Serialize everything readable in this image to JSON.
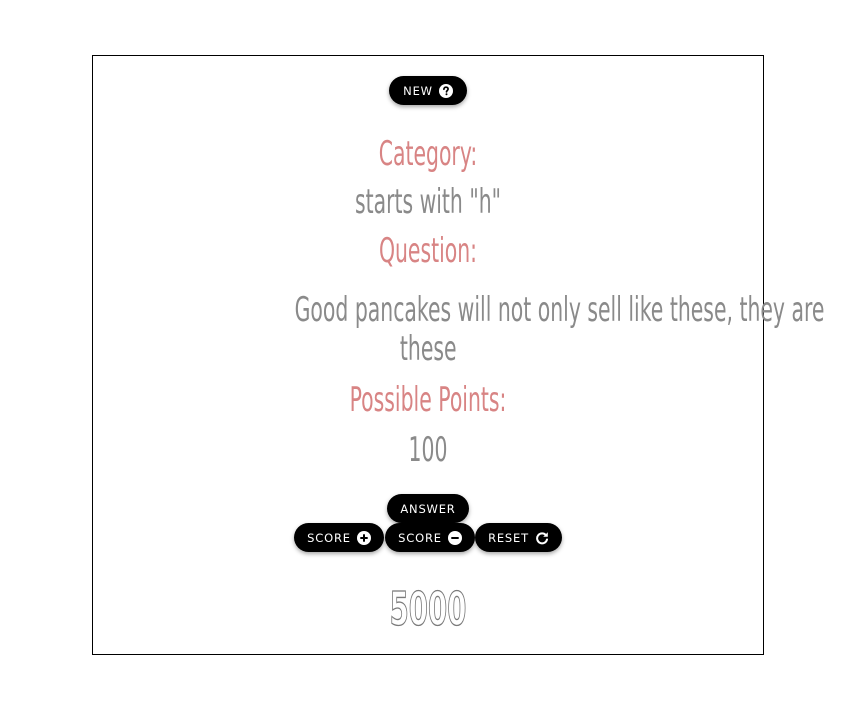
{
  "toolbar": {
    "new_label": "NEW",
    "new_icon": "question-circle-icon"
  },
  "category": {
    "label": "Category:",
    "value": "starts with \"h\""
  },
  "question": {
    "label": "Question:",
    "line1": "Good pancakes will not only sell like these, they are",
    "line2": "these"
  },
  "points": {
    "label": "Possible Points:",
    "value": "100"
  },
  "controls": {
    "answer_label": "ANSWER",
    "score_plus_label": "SCORE",
    "score_plus_icon": "plus-circle-icon",
    "score_minus_label": "SCORE",
    "score_minus_icon": "minus-circle-icon",
    "reset_label": "RESET",
    "reset_icon": "redo-icon"
  },
  "score": {
    "total": "5000"
  },
  "colors": {
    "label_color": "#d88484",
    "value_color": "#8a8a8a",
    "button_bg": "#000000"
  }
}
